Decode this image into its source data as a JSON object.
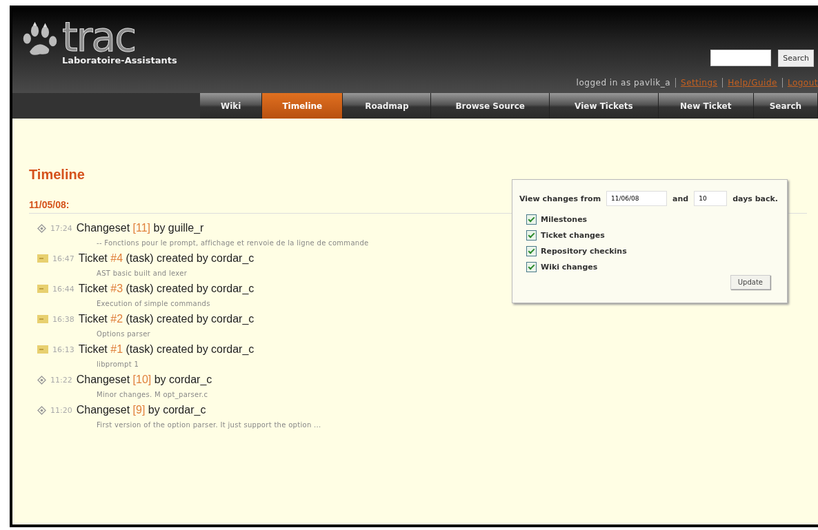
{
  "header": {
    "logo": "trac",
    "project": "Laboratoire-Assistants",
    "search_button": "Search",
    "logged_in": "logged in as pavlik_a",
    "links": [
      "Settings",
      "Help/Guide",
      "Logout"
    ]
  },
  "nav": [
    {
      "label": "Wiki",
      "selected": false
    },
    {
      "label": "Timeline",
      "selected": true
    },
    {
      "label": "Roadmap",
      "selected": false
    },
    {
      "label": "Browse Source",
      "selected": false
    },
    {
      "label": "View Tickets",
      "selected": false
    },
    {
      "label": "New Ticket",
      "selected": false
    },
    {
      "label": "Search",
      "selected": false
    }
  ],
  "title": "Timeline",
  "filter": {
    "from_label": "View changes from",
    "from_value": "11/06/08",
    "and_label": "and",
    "days_value": "10",
    "days_label": "days back.",
    "options": [
      {
        "label": "Milestones",
        "checked": true
      },
      {
        "label": "Ticket changes",
        "checked": true
      },
      {
        "label": "Repository checkins",
        "checked": true
      },
      {
        "label": "Wiki changes",
        "checked": true
      }
    ],
    "button": "Update"
  },
  "day": "11/05/08:",
  "events": [
    {
      "kind": "changeset",
      "time": "17:24",
      "before": "Changeset",
      "link": "[11]",
      "after": "by guille_r",
      "message": "-- Fonctions pour le prompt, affichage et renvoie de la ligne de commande"
    },
    {
      "kind": "ticket",
      "time": "16:47",
      "before": "Ticket",
      "link": "#4",
      "after": "(task) created by cordar_c",
      "message": "AST basic built and lexer"
    },
    {
      "kind": "ticket",
      "time": "16:44",
      "before": "Ticket",
      "link": "#3",
      "after": "(task) created by cordar_c",
      "message": "Execution of simple commands"
    },
    {
      "kind": "ticket",
      "time": "16:38",
      "before": "Ticket",
      "link": "#2",
      "after": "(task) created by cordar_c",
      "message": "Options parser"
    },
    {
      "kind": "ticket",
      "time": "16:13",
      "before": "Ticket",
      "link": "#1",
      "after": "(task) created by cordar_c",
      "message": "libprompt 1"
    },
    {
      "kind": "changeset",
      "time": "11:22",
      "before": "Changeset",
      "link": "[10]",
      "after": "by cordar_c",
      "message": "Minor changes. M opt_parser.c"
    },
    {
      "kind": "changeset",
      "time": "11:20",
      "before": "Changeset",
      "link": "[9]",
      "after": "by cordar_c",
      "message": "First version of the option parser. It just support the option ..."
    }
  ]
}
